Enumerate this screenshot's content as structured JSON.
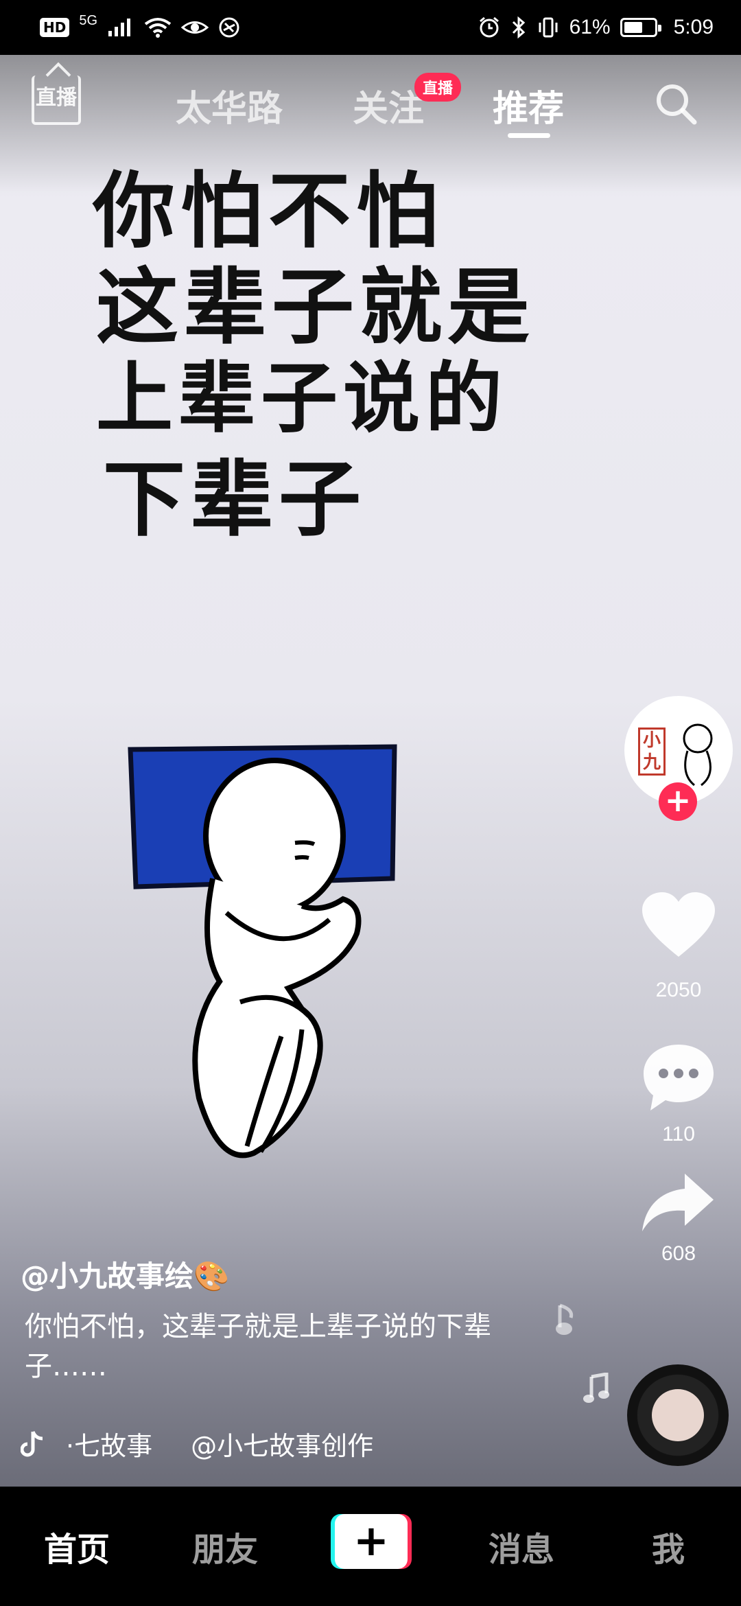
{
  "status_bar": {
    "hd": "HD",
    "network": "5G",
    "battery_text": "61%",
    "battery_level": 0.61,
    "time": "5:09"
  },
  "top_nav": {
    "live_label": "直播",
    "tabs": [
      {
        "label": "太华路",
        "active": false
      },
      {
        "label": "关注",
        "active": false
      },
      {
        "label": "推荐",
        "active": true
      }
    ],
    "follow_badge": "直播",
    "search_icon": "search-icon"
  },
  "video": {
    "handwriting_lines": [
      "你怕不怕",
      "这辈子就是",
      "上辈子说的",
      "下辈子"
    ]
  },
  "side_actions": {
    "avatar_text": "小九",
    "like_count": "2050",
    "comment_count": "110",
    "share_count": "608",
    "icons": [
      "heart-icon",
      "comment-icon",
      "share-icon",
      "music-note-icon"
    ]
  },
  "post": {
    "author": "@小九故事绘🎨",
    "caption": "你怕不怕，这辈子就是上辈子说的下辈子……",
    "music_title": "·七故事",
    "music_credit": "@小七故事创作"
  },
  "bottom_nav": {
    "items": [
      {
        "label": "首页",
        "active": true
      },
      {
        "label": "朋友",
        "active": false
      },
      {
        "label": "消息",
        "active": false
      },
      {
        "label": "我",
        "active": false
      }
    ],
    "add_label": "+"
  },
  "colors": {
    "accent": "#fe2c55",
    "cyan": "#25f4ee",
    "pillow": "#1a3fb5"
  }
}
